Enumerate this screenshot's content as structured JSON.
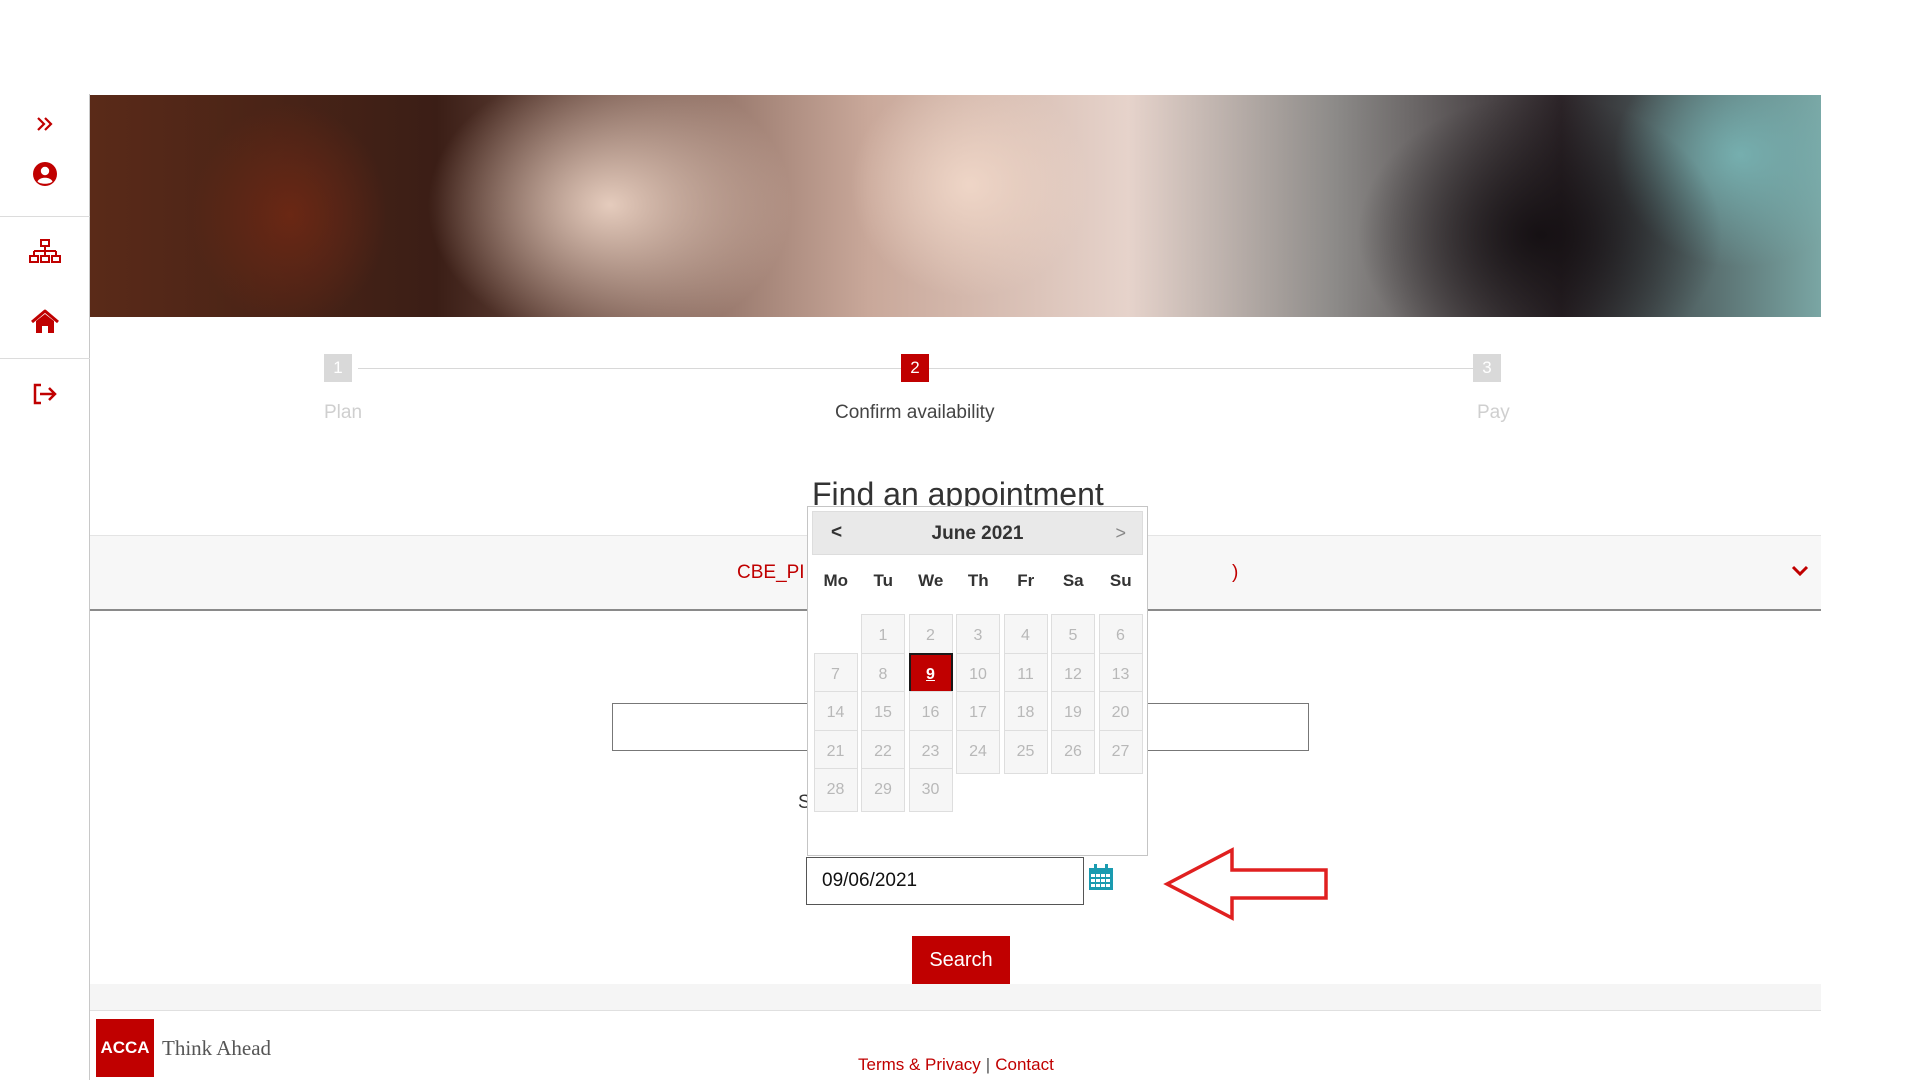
{
  "sidebar": {
    "items": [
      {
        "name": "expand",
        "icon": "double-chevron-right-icon"
      },
      {
        "name": "profile",
        "icon": "user-circle-icon"
      },
      {
        "name": "sitemap",
        "icon": "sitemap-icon"
      },
      {
        "name": "home",
        "icon": "home-icon"
      },
      {
        "name": "logout",
        "icon": "sign-out-icon"
      }
    ]
  },
  "stepper": {
    "steps": [
      {
        "number": "1",
        "label": "Plan",
        "state": "inactive"
      },
      {
        "number": "2",
        "label": "Confirm availability",
        "state": "active"
      },
      {
        "number": "3",
        "label": "Pay",
        "state": "inactive"
      }
    ]
  },
  "main": {
    "title": "Find an appointment",
    "accordion_text_left": "CBE_PI",
    "accordion_text_right": ")",
    "partial_label": "S",
    "date_value": "09/06/2021",
    "search_label": "Search"
  },
  "datepicker": {
    "prev": "<",
    "next": ">",
    "month_year": "June 2021",
    "weekdays": [
      "Mo",
      "Tu",
      "We",
      "Th",
      "Fr",
      "Sa",
      "Su"
    ],
    "first_weekday_offset": 1,
    "days_in_month": 30,
    "selected_day": 9
  },
  "footer": {
    "logo_mark": "ACCA",
    "logo_tagline": "Think Ahead",
    "terms_label": "Terms & Privacy",
    "separator": "|",
    "contact_label": "Contact"
  },
  "colors": {
    "brand_red": "#c00000",
    "calendar_icon": "#1a9bb0",
    "annotation_arrow": "#e02020"
  }
}
